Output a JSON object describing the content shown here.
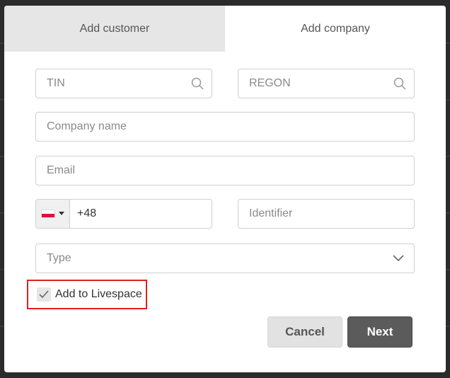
{
  "tabs": [
    {
      "label": "Add customer"
    },
    {
      "label": "Add company"
    }
  ],
  "fields": {
    "tin_placeholder": "TIN",
    "regon_placeholder": "REGON",
    "company_name_placeholder": "Company name",
    "email_placeholder": "Email",
    "phone_value": "+48",
    "identifier_placeholder": "Identifier",
    "type_placeholder": "Type"
  },
  "checkbox": {
    "label": "Add to Livespace",
    "checked": true
  },
  "buttons": {
    "cancel": "Cancel",
    "next": "Next"
  }
}
